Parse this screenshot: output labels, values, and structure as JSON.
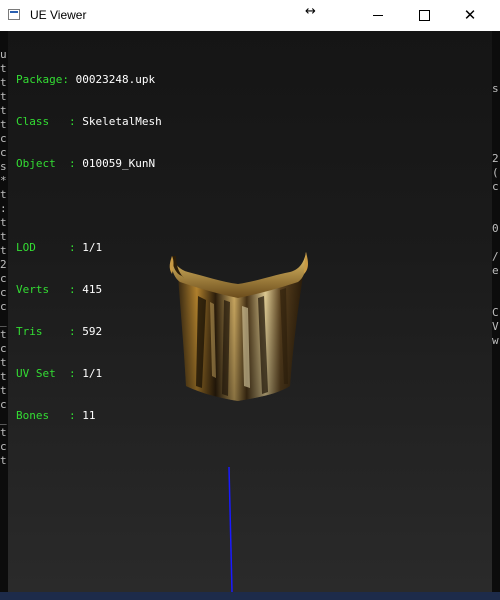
{
  "window": {
    "title": "UE Viewer",
    "controls": {
      "minimize": "minimize-icon",
      "maximize": "maximize-icon",
      "close": "close-icon",
      "resize_glyph": "↔"
    }
  },
  "info": {
    "package_label": "Package",
    "package_value": "00023248.upk",
    "class_label": "Class",
    "class_value": "SkeletalMesh",
    "object_label": "Object",
    "object_value": "010059_KunN",
    "lod_label": "LOD",
    "lod_value": "1/1",
    "verts_label": "Verts",
    "verts_value": "415",
    "tris_label": "Tris",
    "tris_value": "592",
    "uvset_label": "UV Set",
    "uvset_value": "1/1",
    "bones_label": "Bones",
    "bones_value": "11"
  },
  "background_terminal": {
    "left_chars": [
      "u",
      "t",
      "t",
      "t",
      "t",
      "t",
      "c",
      "c",
      "s",
      "*",
      "t",
      ":",
      "t",
      "t",
      "t",
      "2",
      "c",
      "c",
      "c",
      "_",
      "t",
      "c",
      "t",
      "t",
      "t",
      "c",
      "_",
      "t",
      "c",
      "t"
    ],
    "right_chars": [
      "s",
      "",
      "",
      "",
      "",
      "2",
      "(",
      "c",
      "",
      "",
      "0",
      "",
      "/",
      "e",
      "",
      "",
      "C",
      "V",
      "w",
      "",
      ""
    ]
  },
  "colors": {
    "label": "#33dd33",
    "value": "#ffffff",
    "axis": "#1a1aff"
  }
}
